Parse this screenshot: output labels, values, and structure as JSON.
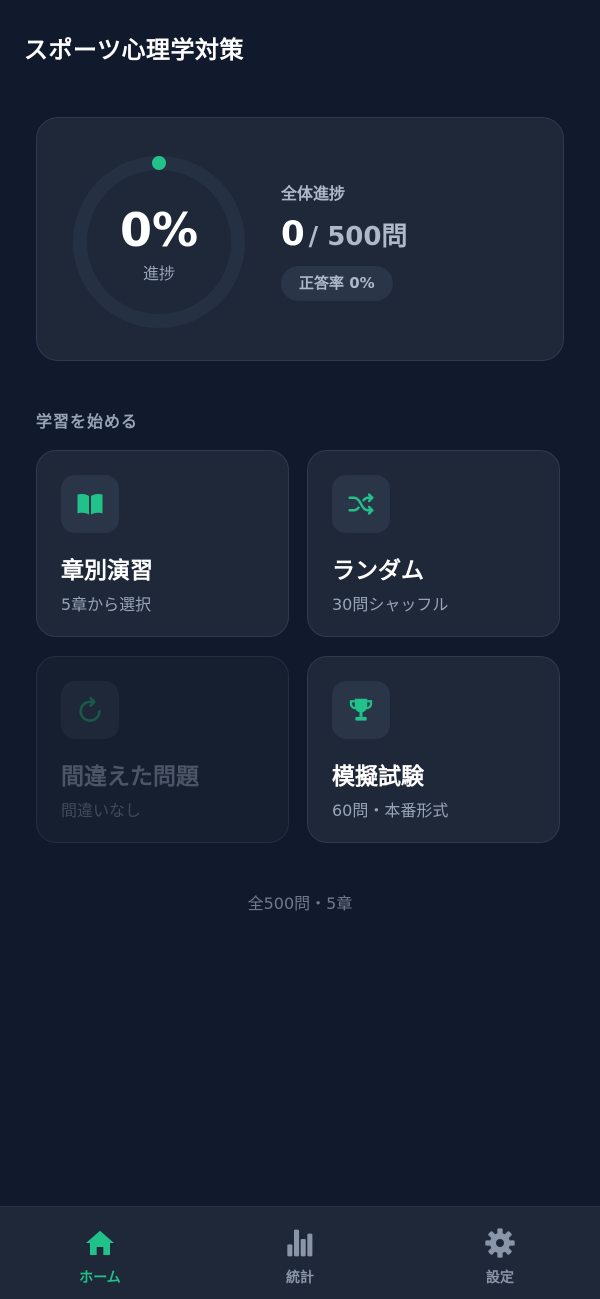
{
  "app": {
    "title": "スポーツ心理学対策"
  },
  "progress": {
    "percent_text": "0%",
    "percent_label": "進捗",
    "percent_value": 0,
    "overall_label": "全体進捗",
    "answered": "0",
    "total": "/ 500問",
    "accuracy": "正答率 0%"
  },
  "section": {
    "title": "学習を始める"
  },
  "modes": {
    "chapter": {
      "title": "章別演習",
      "subtitle": "5章から選択",
      "icon": "book-icon",
      "enabled": true
    },
    "random": {
      "title": "ランダム",
      "subtitle": "30問シャッフル",
      "icon": "shuffle-icon",
      "enabled": true
    },
    "wrong": {
      "title": "間違えた問題",
      "subtitle": "間違いなし",
      "icon": "retry-icon",
      "enabled": false
    },
    "mock": {
      "title": "模擬試験",
      "subtitle": "60問・本番形式",
      "icon": "trophy-icon",
      "enabled": true
    }
  },
  "footer": {
    "note": "全500問・5章"
  },
  "nav": {
    "items": [
      {
        "label": "ホーム",
        "icon": "home-icon",
        "active": true
      },
      {
        "label": "統計",
        "icon": "stats-icon",
        "active": false
      },
      {
        "label": "設定",
        "icon": "gear-icon",
        "active": false
      }
    ]
  },
  "colors": {
    "background": "#111a2c",
    "card": "#1e2839",
    "accent": "#21c18a",
    "muted_text": "#97a3b6"
  }
}
